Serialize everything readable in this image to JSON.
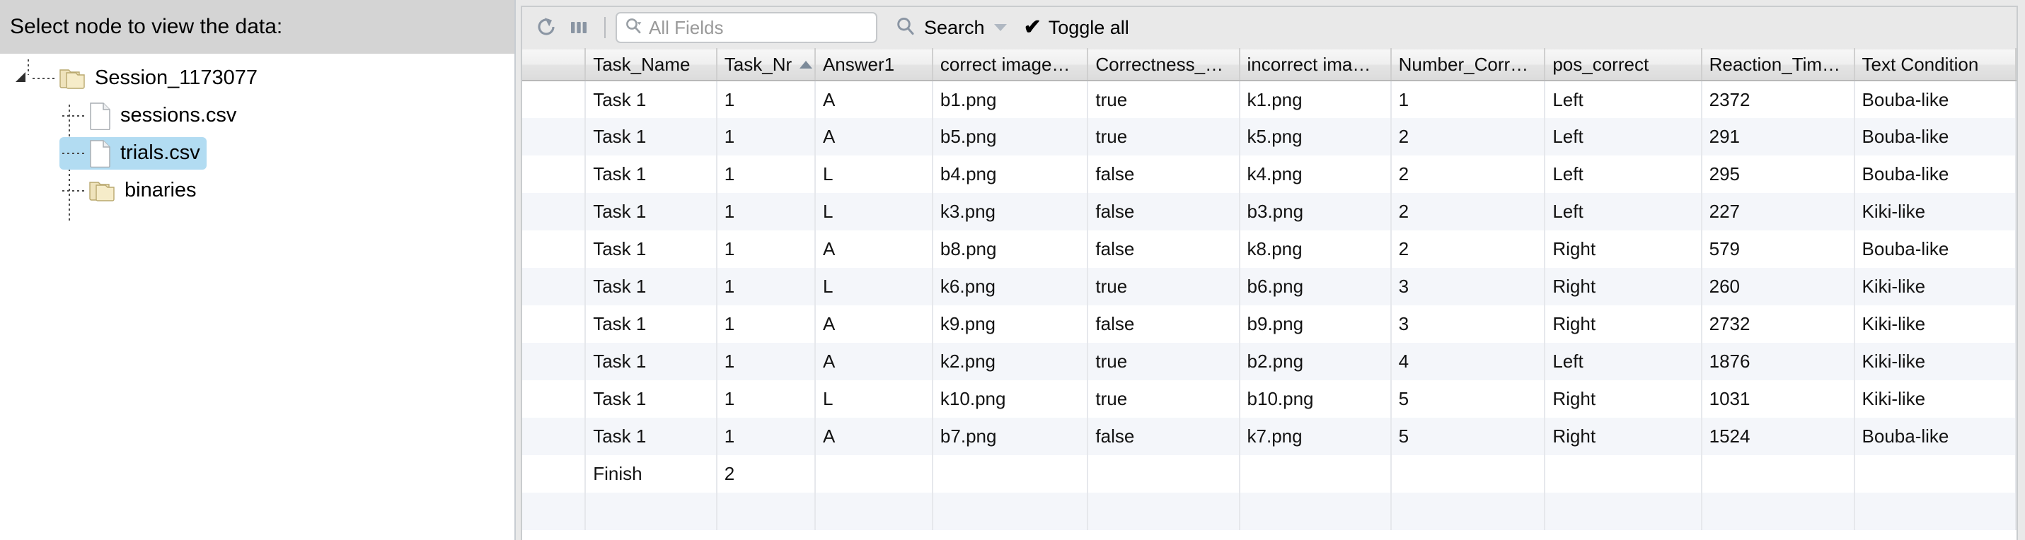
{
  "tree_panel": {
    "header_label": "Select node to view the data:",
    "nodes": [
      {
        "label": "Session_1173077",
        "icon": "folder-icon",
        "depth": 0,
        "expanded": true,
        "selected": false
      },
      {
        "label": "sessions.csv",
        "icon": "file-icon",
        "depth": 1,
        "expanded": false,
        "selected": false
      },
      {
        "label": "trials.csv",
        "icon": "file-icon",
        "depth": 1,
        "expanded": false,
        "selected": true
      },
      {
        "label": "binaries",
        "icon": "folder-icon",
        "depth": 1,
        "expanded": false,
        "selected": false
      }
    ]
  },
  "toolbar": {
    "refresh_icon": "refresh-icon",
    "columns_icon": "columns-icon",
    "search_field": {
      "icon": "search-dropdown-icon",
      "value": "",
      "placeholder": "All Fields"
    },
    "search_button": {
      "icon": "search-icon",
      "label": "Search",
      "caret_icon": "chevron-down-icon"
    },
    "toggle_all_button": {
      "icon": "check-icon",
      "label": "Toggle all"
    }
  },
  "table": {
    "gutter_header": "",
    "columns": [
      {
        "label": "Task_Name",
        "sort": "none"
      },
      {
        "label": "Task_Nr",
        "sort": "asc"
      },
      {
        "label": "Answer1",
        "sort": "none"
      },
      {
        "label": "correct image…",
        "sort": "none"
      },
      {
        "label": "Correctness_…",
        "sort": "none"
      },
      {
        "label": "incorrect ima…",
        "sort": "none"
      },
      {
        "label": "Number_Corr…",
        "sort": "none"
      },
      {
        "label": "pos_correct",
        "sort": "none"
      },
      {
        "label": "Reaction_Tim…",
        "sort": "none"
      },
      {
        "label": "Text Condition",
        "sort": "none"
      }
    ],
    "rows": [
      [
        "Task 1",
        "1",
        "A",
        "b1.png",
        "true",
        "k1.png",
        "1",
        "Left",
        "2372",
        "Bouba-like"
      ],
      [
        "Task 1",
        "1",
        "A",
        "b5.png",
        "true",
        "k5.png",
        "2",
        "Left",
        "291",
        "Bouba-like"
      ],
      [
        "Task 1",
        "1",
        "L",
        "b4.png",
        "false",
        "k4.png",
        "2",
        "Left",
        "295",
        "Bouba-like"
      ],
      [
        "Task 1",
        "1",
        "L",
        "k3.png",
        "false",
        "b3.png",
        "2",
        "Left",
        "227",
        "Kiki-like"
      ],
      [
        "Task 1",
        "1",
        "A",
        "b8.png",
        "false",
        "k8.png",
        "2",
        "Right",
        "579",
        "Bouba-like"
      ],
      [
        "Task 1",
        "1",
        "L",
        "k6.png",
        "true",
        "b6.png",
        "3",
        "Right",
        "260",
        "Kiki-like"
      ],
      [
        "Task 1",
        "1",
        "A",
        "k9.png",
        "false",
        "b9.png",
        "3",
        "Right",
        "2732",
        "Kiki-like"
      ],
      [
        "Task 1",
        "1",
        "A",
        "k2.png",
        "true",
        "b2.png",
        "4",
        "Left",
        "1876",
        "Kiki-like"
      ],
      [
        "Task 1",
        "1",
        "L",
        "k10.png",
        "true",
        "b10.png",
        "5",
        "Right",
        "1031",
        "Kiki-like"
      ],
      [
        "Task 1",
        "1",
        "A",
        "b7.png",
        "false",
        "k7.png",
        "5",
        "Right",
        "1524",
        "Bouba-like"
      ],
      [
        "Finish",
        "2",
        "",
        "",
        "",
        "",
        "",
        "",
        "",
        ""
      ],
      [
        "",
        "",
        "",
        "",
        "",
        "",
        "",
        "",
        "",
        ""
      ]
    ]
  },
  "colors": {
    "tree_header_bg": "#d4d4d4",
    "selection_bg": "#b2dcf2",
    "panel_bg": "#e9e9e9",
    "row_stripe": "#f4f6fa",
    "icon_blue_gray": "#8a95a3",
    "folder_tan": "#e8d9a8"
  }
}
